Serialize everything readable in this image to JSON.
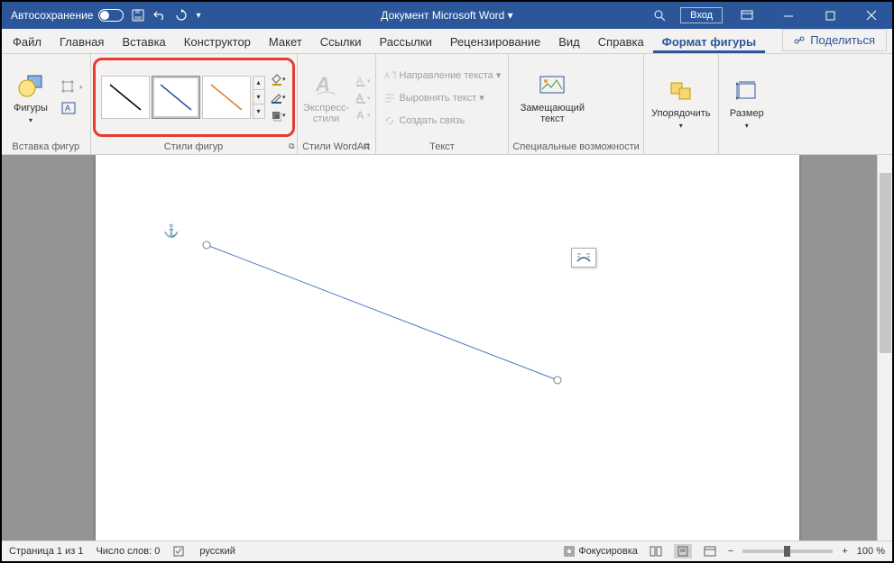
{
  "titlebar": {
    "autosave_label": "Автосохранение",
    "doc_title": "Документ Microsoft Word ▾",
    "login_label": "Вход"
  },
  "tabs": {
    "items": [
      "Файл",
      "Главная",
      "Вставка",
      "Конструктор",
      "Макет",
      "Ссылки",
      "Рассылки",
      "Рецензирование",
      "Вид",
      "Справка",
      "Формат фигуры"
    ],
    "active_index": 10,
    "share_label": "Поделиться"
  },
  "ribbon": {
    "insert_shapes": {
      "shapes_label": "Фигуры",
      "group_label": "Вставка фигур"
    },
    "shape_styles": {
      "group_label": "Стили фигур"
    },
    "wordart": {
      "express_label": "Экспресс-стили",
      "group_label": "Стили WordArt"
    },
    "text": {
      "direction_label": "Направление текста ▾",
      "align_label": "Выровнять текст ▾",
      "link_label": "Создать связь",
      "group_label": "Текст"
    },
    "accessibility": {
      "alt_text_label": "Замещающий текст",
      "group_label": "Специальные возможности"
    },
    "arrange": {
      "label": "Упорядочить",
      "group_label": ""
    },
    "size": {
      "label": "Размер",
      "group_label": ""
    }
  },
  "statusbar": {
    "page_label": "Страница 1 из 1",
    "words_label": "Число слов: 0",
    "language_label": "русский",
    "focus_label": "Фокусировка",
    "zoom_label": "100 %"
  }
}
